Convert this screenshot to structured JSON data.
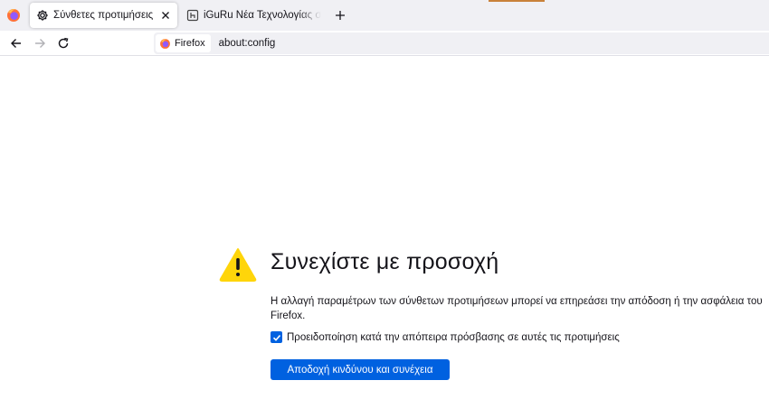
{
  "tabs": [
    {
      "title": "Σύνθετες προτιμήσεις",
      "icon": "gear-icon",
      "active": true
    },
    {
      "title": "iGuRu Νέα Τεχνολογίας σε προ",
      "icon": "iguru-favicon-icon",
      "active": false
    }
  ],
  "navbar": {
    "identity_label": "Firefox",
    "url": "about:config"
  },
  "warning": {
    "title": "Συνεχίστε με προσοχή",
    "description": "Η αλλαγή παραμέτρων των σύνθετων προτιμήσεων μπορεί να επηρεάσει την απόδοση ή την ασφάλεια του Firefox.",
    "checkbox_label": "Προειδοποίηση κατά την απόπειρα πρόσβασης σε αυτές τις προτιμήσεις",
    "checkbox_checked": true,
    "accept_button": "Αποδοχή κινδύνου και συνέχεια"
  },
  "colors": {
    "accent_blue": "#0061e0",
    "warning_yellow": "#ffd50a",
    "tabstrip_bg": "#f0f0f4"
  }
}
